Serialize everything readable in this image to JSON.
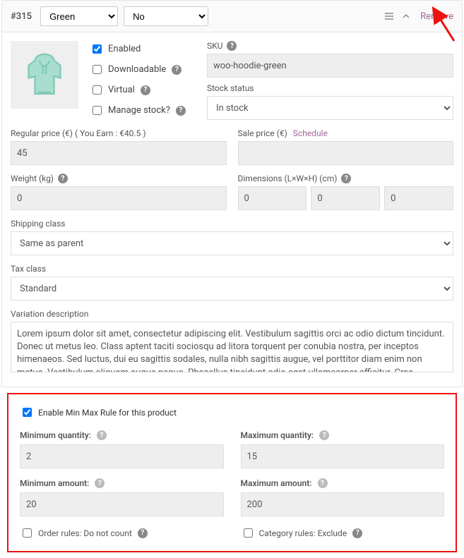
{
  "header": {
    "id": "#315",
    "attr1_selected": "Green",
    "attr2_selected": "No",
    "remove_label": "Remove"
  },
  "checkboxes": {
    "enabled": {
      "label": "Enabled",
      "checked": true
    },
    "downloadable": {
      "label": "Downloadable",
      "checked": false
    },
    "virtual": {
      "label": "Virtual",
      "checked": false
    },
    "manage_stock": {
      "label": "Manage stock?",
      "checked": false
    }
  },
  "sku": {
    "label": "SKU",
    "value": "woo-hoodie-green"
  },
  "stock_status": {
    "label": "Stock status",
    "value": "In stock"
  },
  "regular_price": {
    "label": "Regular price (€) ( You Earn : €40.5 )",
    "value": "45"
  },
  "sale_price": {
    "label": "Sale price (€)",
    "schedule": "Schedule",
    "value": ""
  },
  "weight": {
    "label": "Weight (kg)",
    "value": "0"
  },
  "dimensions": {
    "label": "Dimensions (L×W×H) (cm)",
    "l": "0",
    "w": "0",
    "h": "0"
  },
  "shipping_class": {
    "label": "Shipping class",
    "value": "Same as parent"
  },
  "tax_class": {
    "label": "Tax class",
    "value": "Standard"
  },
  "description": {
    "label": "Variation description",
    "value": "Lorem ipsum dolor sit amet, consectetur adipiscing elit. Vestibulum sagittis orci ac odio dictum tincidunt. Donec ut metus leo. Class aptent taciti sociosqu ad litora torquent per conubia nostra, per inceptos himenaeos. Sed luctus, dui eu sagittis sodales, nulla nibh sagittis augue, vel porttitor diam enim non metus. Vestibulum aliquam augue neque. Phasellus tincidunt odio eget ullamcorper efficitur. Cras placerat ut"
  },
  "minmax": {
    "enable": {
      "label": "Enable Min Max Rule for this product",
      "checked": true
    },
    "min_qty": {
      "label": "Minimum quantity:",
      "value": "2"
    },
    "max_qty": {
      "label": "Maximum quantity:",
      "value": "15"
    },
    "min_amt": {
      "label": "Minimum amount:",
      "value": "20"
    },
    "max_amt": {
      "label": "Maximum amount:",
      "value": "200"
    },
    "order_rules": {
      "label": "Order rules: Do not count",
      "checked": false
    },
    "category_rules": {
      "label": "Category rules: Exclude",
      "checked": false
    }
  }
}
